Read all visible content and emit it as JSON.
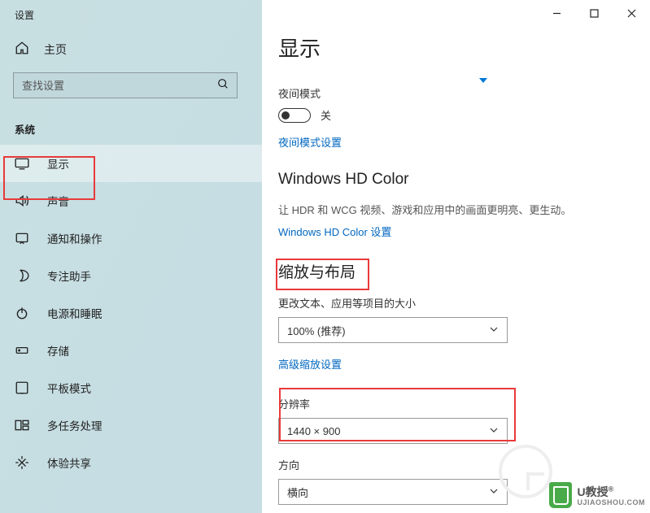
{
  "window_title": "设置",
  "home_label": "主页",
  "search_placeholder": "查找设置",
  "section_label": "系统",
  "nav": [
    {
      "label": "显示"
    },
    {
      "label": "声音"
    },
    {
      "label": "通知和操作"
    },
    {
      "label": "专注助手"
    },
    {
      "label": "电源和睡眠"
    },
    {
      "label": "存储"
    },
    {
      "label": "平板模式"
    },
    {
      "label": "多任务处理"
    },
    {
      "label": "体验共享"
    }
  ],
  "main": {
    "title": "显示",
    "night_mode_label": "夜间模式",
    "toggle_state": "关",
    "night_mode_link": "夜间模式设置",
    "hd_color_heading": "Windows HD Color",
    "hd_color_desc": "让 HDR 和 WCG 视频、游戏和应用中的画面更明亮、更生动。",
    "hd_color_link": "Windows HD Color 设置",
    "scale_heading": "缩放与布局",
    "scale_field_label": "更改文本、应用等项目的大小",
    "scale_value": "100% (推荐)",
    "advanced_scale_link": "高级缩放设置",
    "resolution_label": "分辨率",
    "resolution_value": "1440 × 900",
    "orientation_label": "方向",
    "orientation_value": "横向"
  },
  "watermark": {
    "brand": "U教授",
    "sub": "UJIAOSHOU.COM"
  }
}
